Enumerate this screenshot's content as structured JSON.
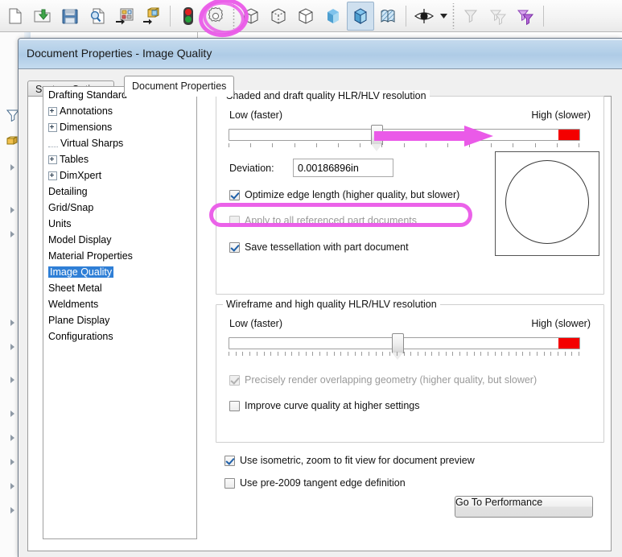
{
  "toolbar": {
    "items": [
      {
        "name": "new-document-icon",
        "glyph": "page"
      },
      {
        "name": "open-document-icon",
        "glyph": "open-folder"
      },
      {
        "name": "save-icon",
        "glyph": "floppy"
      },
      {
        "name": "print-preview-icon",
        "glyph": "page-magnifier"
      },
      {
        "name": "print-icon",
        "glyph": "print-layout"
      },
      {
        "name": "pack-and-go-icon",
        "glyph": "yellow-box"
      },
      {
        "name": "rebuild-icon",
        "glyph": "traffic-light"
      },
      {
        "name": "options-gear-icon",
        "glyph": "gear"
      },
      {
        "name": "wireframe-icon",
        "glyph": "cube-wire"
      },
      {
        "name": "hidden-lines-visible-icon",
        "glyph": "cube-dashed"
      },
      {
        "name": "hidden-lines-removed-icon",
        "glyph": "cube-plain"
      },
      {
        "name": "shaded-icon",
        "glyph": "cube-blue"
      },
      {
        "name": "shaded-with-edges-icon",
        "glyph": "cube-blue-edges"
      },
      {
        "name": "section-view-icon",
        "glyph": "section-hatch"
      },
      {
        "name": "display-style-icon",
        "glyph": "eye"
      },
      {
        "name": "hide-show-items-icon",
        "glyph": "funnel-gray"
      },
      {
        "name": "view-settings-icon",
        "glyph": "funnel-stack-gray"
      },
      {
        "name": "apply-scene-icon",
        "glyph": "funnel-stack-purple"
      }
    ]
  },
  "dialog": {
    "title": "Document Properties - Image Quality",
    "tabs": [
      {
        "id": "system-options",
        "label": "System Options",
        "active": false
      },
      {
        "id": "document-properties",
        "label": "Document Properties",
        "active": true
      }
    ]
  },
  "tree": {
    "items": [
      {
        "label": "Drafting Standard",
        "lead": "none",
        "selected": false
      },
      {
        "label": "Annotations",
        "lead": "expander",
        "selected": false
      },
      {
        "label": "Dimensions",
        "lead": "expander",
        "selected": false
      },
      {
        "label": "Virtual Sharps",
        "lead": "dots",
        "selected": false
      },
      {
        "label": "Tables",
        "lead": "expander",
        "selected": false
      },
      {
        "label": "DimXpert",
        "lead": "expander",
        "selected": false
      },
      {
        "label": "Detailing",
        "lead": "none",
        "selected": false
      },
      {
        "label": "Grid/Snap",
        "lead": "none",
        "selected": false
      },
      {
        "label": "Units",
        "lead": "none",
        "selected": false
      },
      {
        "label": "Model Display",
        "lead": "none",
        "selected": false
      },
      {
        "label": "Material Properties",
        "lead": "none",
        "selected": false
      },
      {
        "label": "Image Quality",
        "lead": "none",
        "selected": true
      },
      {
        "label": "Sheet Metal",
        "lead": "none",
        "selected": false
      },
      {
        "label": "Weldments",
        "lead": "none",
        "selected": false
      },
      {
        "label": "Plane Display",
        "lead": "none",
        "selected": false
      },
      {
        "label": "Configurations",
        "lead": "none",
        "selected": false
      }
    ]
  },
  "shaded_group": {
    "title": "Shaded and draft quality HLR/HLV resolution",
    "low_label": "Low (faster)",
    "high_label": "High (slower)",
    "slider_percent": 42,
    "slider_ticks": 17,
    "deviation_label": "Deviation:",
    "deviation_value": "0.00186896in",
    "checkboxes": [
      {
        "id": "optimize-edge-length",
        "label": "Optimize edge length (higher quality, but slower)",
        "checked": true,
        "disabled": false
      },
      {
        "id": "apply-to-all-referenced",
        "label": "Apply to all referenced part documents",
        "checked": false,
        "disabled": true
      },
      {
        "id": "save-tessellation",
        "label": "Save tessellation with part document",
        "checked": true,
        "disabled": false
      }
    ]
  },
  "wireframe_group": {
    "title": "Wireframe and high quality HLR/HLV resolution",
    "low_label": "Low (faster)",
    "high_label": "High (slower)",
    "slider_percent": 48,
    "slider_ticks": 51,
    "checkboxes": [
      {
        "id": "precisely-render-overlapping",
        "label": "Precisely render overlapping geometry (higher quality, but slower)",
        "checked": true,
        "disabled": true
      },
      {
        "id": "improve-curve-quality",
        "label": "Improve curve quality at higher settings",
        "checked": false,
        "disabled": false
      }
    ]
  },
  "footer": {
    "checkboxes": [
      {
        "id": "use-isometric-zoom-to-fit",
        "label": "Use isometric, zoom to fit view for document preview",
        "checked": true,
        "disabled": false
      },
      {
        "id": "use-pre-2009-tangent-edge",
        "label": "Use pre-2009 tangent edge definition",
        "checked": false,
        "disabled": false
      }
    ],
    "go_to_performance_label": "Go To Performance"
  },
  "annotations": {
    "color": "#ea5ae8",
    "items": [
      {
        "name": "gear-highlight-circle",
        "shape": "circle"
      },
      {
        "name": "slider-direction-arrow",
        "shape": "arrow-right"
      },
      {
        "name": "optimize-edge-length-highlight",
        "shape": "rounded-rect"
      }
    ]
  }
}
